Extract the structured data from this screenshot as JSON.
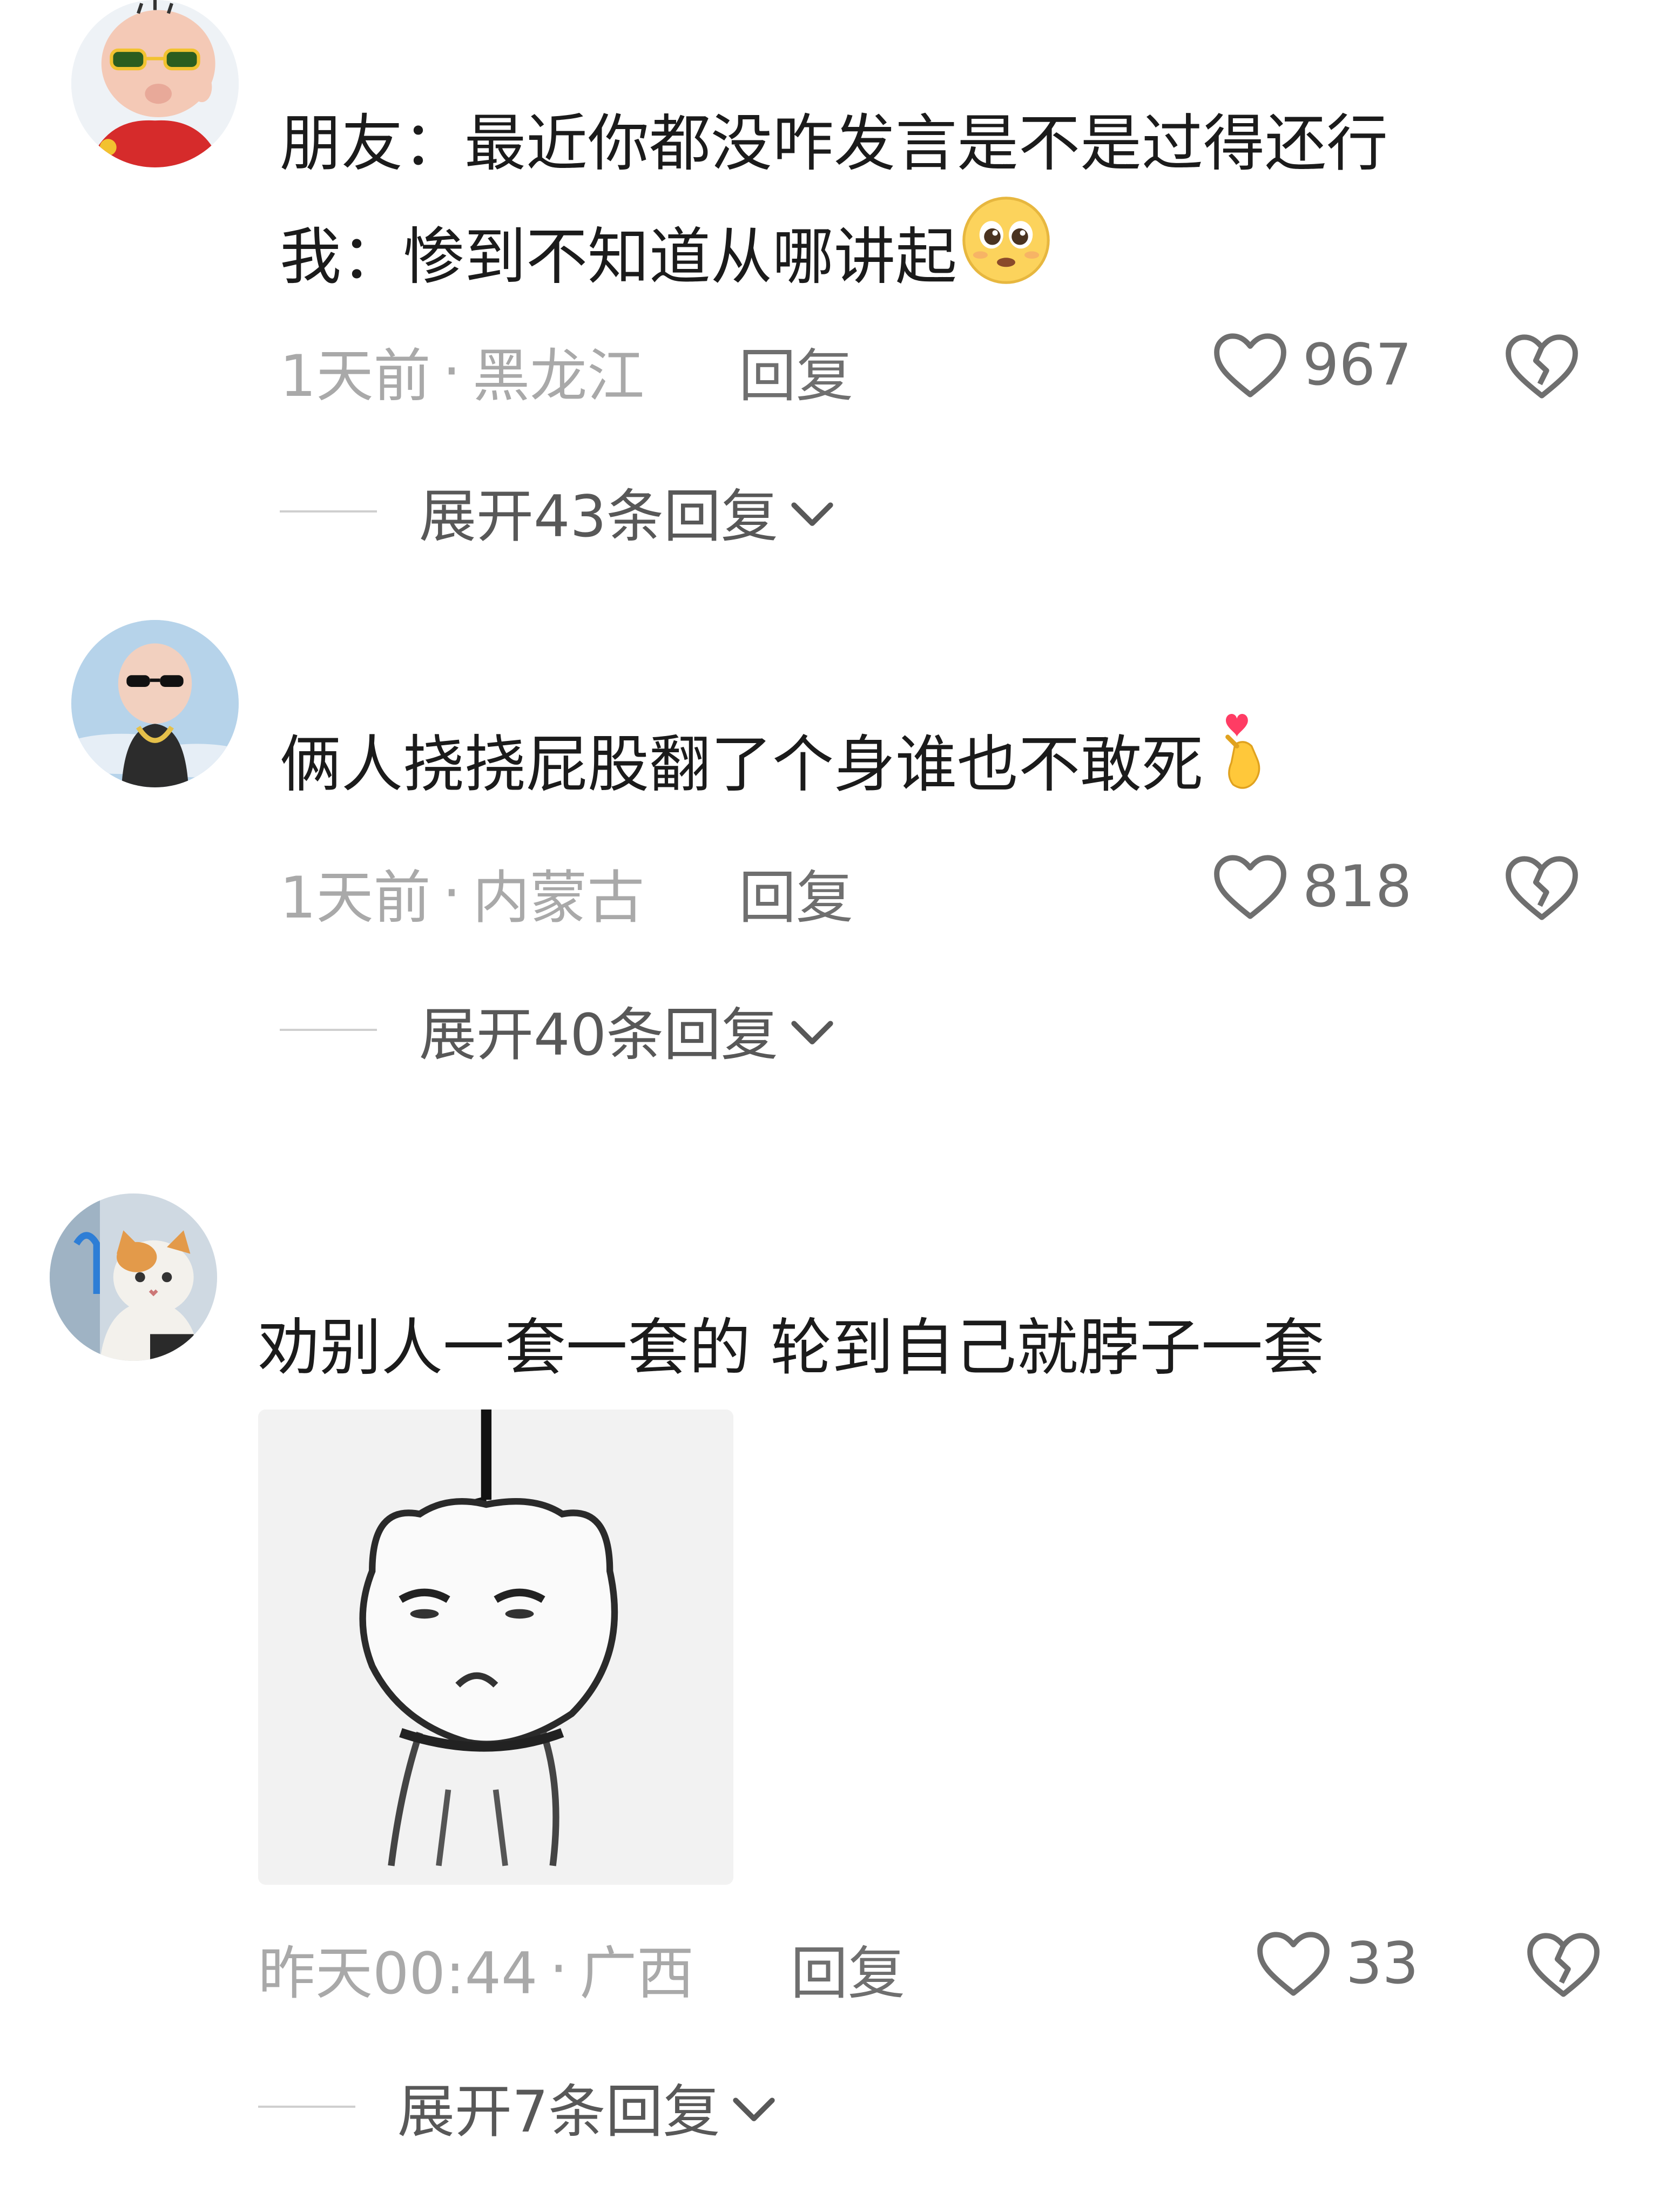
{
  "comments": [
    {
      "lines": [
        "朋友：最近你都没咋发言是不是过得还行",
        "我：惨到不知道从哪讲起"
      ],
      "time": "1天前",
      "sep": "·",
      "location": "黑龙江",
      "reply_label": "回复",
      "likes": "967",
      "expand_label": "展开43条回复",
      "emoji": "pleading-face"
    },
    {
      "lines": [
        "俩人挠挠屁股翻了个身谁也不敢死"
      ],
      "time": "1天前",
      "sep": "·",
      "location": "内蒙古",
      "reply_label": "回复",
      "likes": "818",
      "expand_label": "展开40条回复",
      "emoji": "finger-heart"
    },
    {
      "lines": [
        "劝别人一套一套的 轮到自己就脖子一套"
      ],
      "time": "昨天00:44",
      "sep": "·",
      "location": "广西",
      "reply_label": "回复",
      "likes": "33",
      "expand_label": "展开7条回复",
      "image": "hanging-cartoon-meme"
    }
  ],
  "icons": {
    "like": "heart-outline-icon",
    "dislike": "broken-heart-icon",
    "expand": "chevron-down-icon"
  },
  "colors": {
    "text": "#1b1b1b",
    "meta": "#a9a9a9",
    "action": "#6f6f6f"
  }
}
